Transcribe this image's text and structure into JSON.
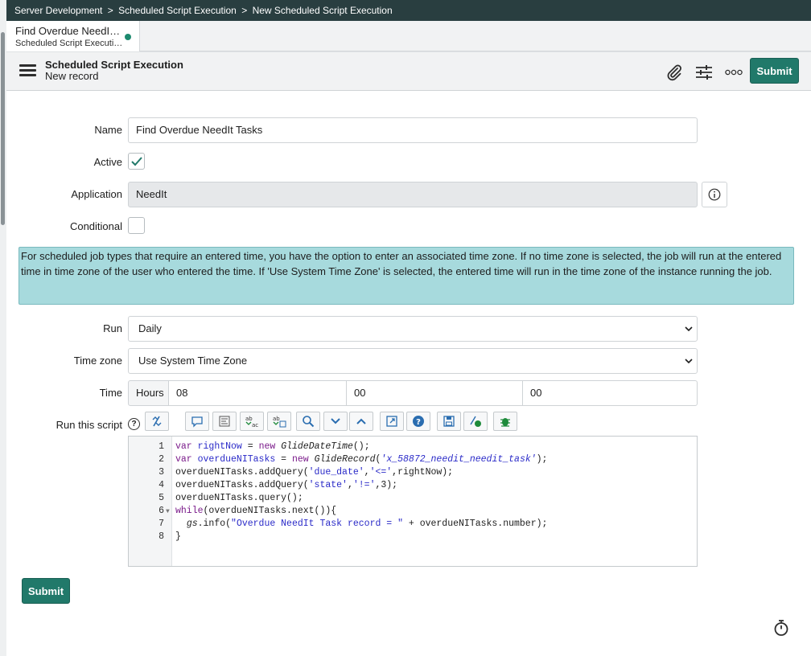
{
  "breadcrumb": {
    "items": [
      "Server Development",
      "Scheduled Script Execution",
      "New Scheduled Script Execution"
    ],
    "separator": ">"
  },
  "tab": {
    "title": "Find Overdue NeedI…",
    "subtitle": "Scheduled Script Executi…",
    "status_color": "#1d8a6f"
  },
  "header": {
    "menu_icon": "hamburger-icon",
    "title": "Scheduled Script Execution",
    "subtitle": "New record",
    "icons": [
      "paperclip-icon",
      "sliders-icon",
      "more-icon"
    ],
    "submit_label": "Submit"
  },
  "fields": {
    "name_label": "Name",
    "name_value": "Find Overdue NeedIt Tasks",
    "active_label": "Active",
    "active_checked": true,
    "application_label": "Application",
    "application_value": "NeedIt",
    "conditional_label": "Conditional",
    "conditional_checked": false
  },
  "notice": {
    "text": "For scheduled job types that require an entered time, you have the option to enter an associated time zone. If no time zone is selected, the job will run at the entered time in time zone of the user who entered the time. If 'Use System Time Zone' is selected, the entered time will run in the time zone of the instance running the job."
  },
  "schedule": {
    "run_label": "Run",
    "run_value": "Daily",
    "timezone_label": "Time zone",
    "timezone_value": "Use System Time Zone",
    "time_label": "Time",
    "time_prefix": "Hours",
    "hours": "08",
    "minutes": "00",
    "seconds": "00"
  },
  "script": {
    "label": "Run this script",
    "help": "?",
    "toolbar_icons": [
      "toggle-syntax-icon",
      "comment-icon",
      "format-icon",
      "replace-icon",
      "replace-all-icon",
      "search-icon",
      "collapse-icon",
      "expand-icon",
      "fullscreen-icon",
      "help-icon",
      "save-icon",
      "script-debugger-icon",
      "debug-icon"
    ],
    "line_numbers": [
      "1",
      "2",
      "3",
      "4",
      "5",
      "6",
      "7",
      "8"
    ],
    "lines": {
      "l1": [
        "var",
        "rightNow",
        "=",
        "new",
        "GlideDateTime",
        "();"
      ],
      "l2": [
        "var",
        "overdueNITasks",
        "=",
        "new",
        "GlideRecord",
        "(",
        "'x_58872_needit_needit_task'",
        ");"
      ],
      "l3": [
        "overdueNITasks.addQuery(",
        "'due_date'",
        ",",
        "'<='",
        ",rightNow);"
      ],
      "l4": [
        "overdueNITasks.addQuery(",
        "'state'",
        ",",
        "'!='",
        ",3);"
      ],
      "l5": "overdueNITasks.query();",
      "l6": [
        "while",
        "(overdueNITasks.next()){"
      ],
      "l7": [
        "  ",
        "gs",
        ".info(",
        "\"Overdue NeedIt Task record = \"",
        " + overdueNITasks.number);"
      ],
      "l8": "}"
    }
  },
  "footer": {
    "submit_label": "Submit",
    "timer_icon": "stopwatch-icon"
  },
  "colors": {
    "breadcrumb_bg": "#293e40",
    "accent": "#21796a",
    "notice_bg": "#a7dadd"
  }
}
